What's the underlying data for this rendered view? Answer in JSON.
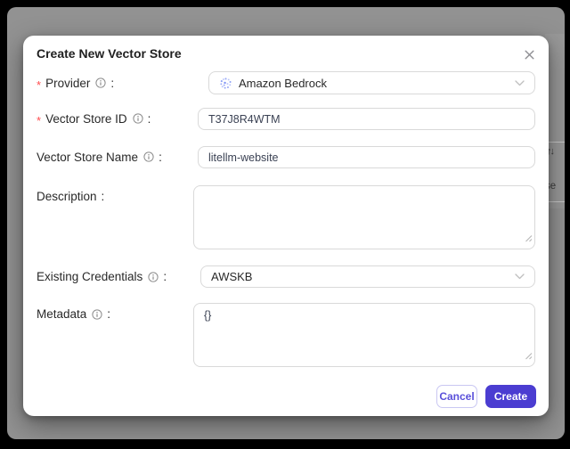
{
  "modal": {
    "title": "Create New Vector Store",
    "required_marker": "*",
    "label_colon": ":",
    "fields": {
      "provider": {
        "label": "Provider",
        "value": "Amazon Bedrock"
      },
      "vector_store_id": {
        "label": "Vector Store ID",
        "value": "T37J8R4WTM"
      },
      "vector_store_name": {
        "label": "Vector Store Name",
        "value": "litellm-website"
      },
      "description": {
        "label": "Description",
        "value": ""
      },
      "existing_credentials": {
        "label": "Existing Credentials",
        "value": "AWSKB"
      },
      "metadata": {
        "label": "Metadata",
        "value": "{}"
      }
    },
    "buttons": {
      "cancel": "Cancel",
      "create": "Create"
    }
  },
  "background": {
    "sort_icon": "↑↓",
    "partial_text": "se"
  },
  "colors": {
    "primary": "#4b3dd1",
    "required": "#ff4d4f",
    "input_border": "#d9d9d9",
    "overlay": "#929292",
    "bedrock_icon": "#93a5f5"
  }
}
